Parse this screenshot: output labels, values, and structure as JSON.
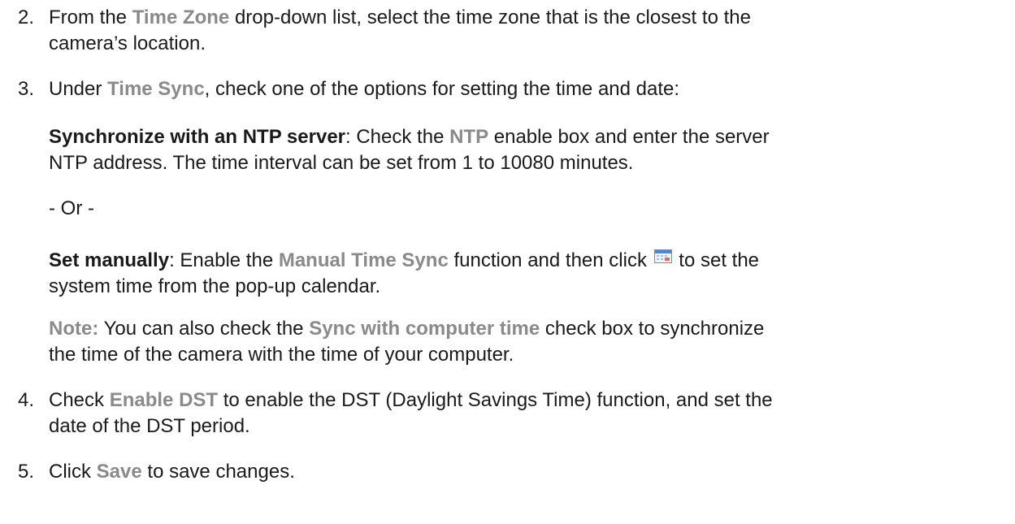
{
  "steps": [
    {
      "number": "2.",
      "pre": "From the ",
      "ui": "Time Zone",
      "post1": " drop-down list, select the time zone that is the closest to the",
      "post2": "camera’s location."
    },
    {
      "number": "3.",
      "pre": "Under ",
      "ui": "Time Sync",
      "post": ", check one of the options for setting the time and date:"
    },
    {
      "number": "4.",
      "pre": "Check ",
      "ui": "Enable DST",
      "post1": " to enable the DST (Daylight Savings Time) function, and set the",
      "post2": "date of the DST period."
    },
    {
      "number": "5.",
      "pre": "Click ",
      "ui": "Save",
      "post": " to save changes."
    }
  ],
  "ntp": {
    "label": "Synchronize with an NTP server",
    "pre": ": Check the ",
    "ui": "NTP",
    "post1": " enable box and enter the server",
    "post2": "NTP address. The time interval can be set from 1 to 10080 minutes."
  },
  "or_text": "- Or -",
  "manual": {
    "label": "Set manually",
    "pre": ": Enable the ",
    "ui": "Manual Time Sync",
    "post1a": " function and then click ",
    "post1b": " to set the",
    "post2": "system time from the pop-up calendar."
  },
  "note": {
    "label": "Note:",
    "pre": " You can also check the ",
    "ui": "Sync with computer time",
    "post1": " check box to synchronize",
    "post2": "the time of the camera with the time of your computer."
  },
  "icons": {
    "calendar": "calendar-icon"
  }
}
